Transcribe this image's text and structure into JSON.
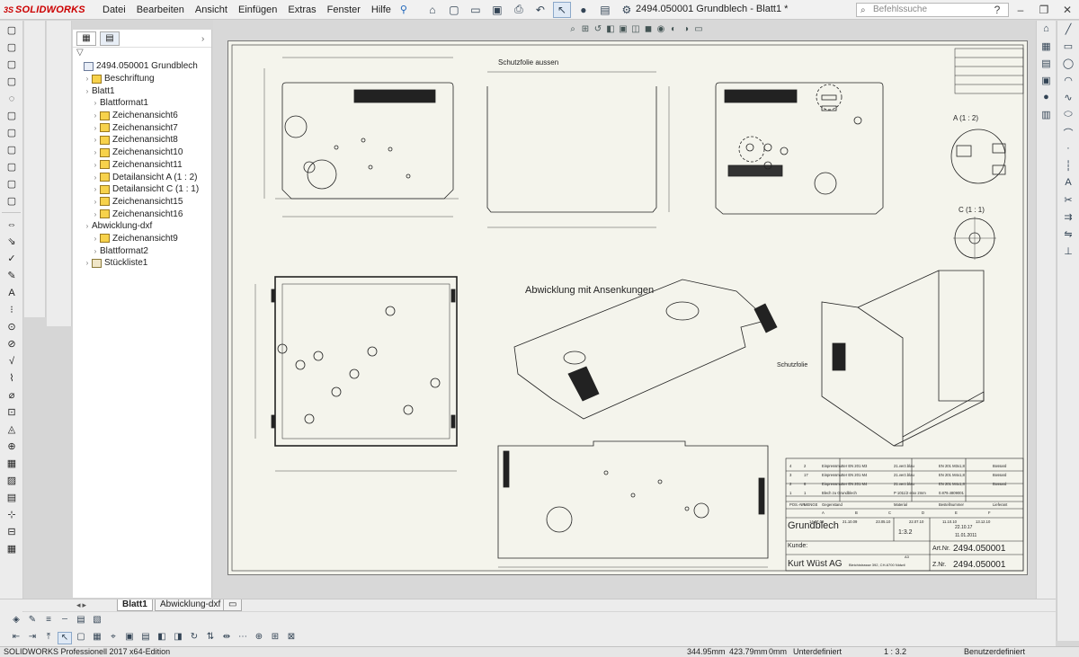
{
  "app": {
    "logo_prefix": "3S",
    "logo_name": "SOLIDWORKS",
    "menu": [
      "Datei",
      "Bearbeiten",
      "Ansicht",
      "Einfügen",
      "Extras",
      "Fenster",
      "Hilfe"
    ],
    "document_title": "2494.050001 Grundblech - Blatt1 *",
    "search_placeholder": "Befehlssuche"
  },
  "feature_tree": {
    "nodes": [
      {
        "label": "2494.050001 Grundblech",
        "level": 0,
        "icon": "drawing-icon"
      },
      {
        "label": "Beschriftung",
        "level": 1,
        "icon": "annotation-folder-icon"
      },
      {
        "label": "Blatt1",
        "level": 1,
        "icon": "sheet-icon"
      },
      {
        "label": "Blattformat1",
        "level": 2,
        "icon": "sheet-format-icon"
      },
      {
        "label": "Zeichenansicht6",
        "level": 2,
        "icon": "drawing-view-icon"
      },
      {
        "label": "Zeichenansicht7",
        "level": 2,
        "icon": "drawing-view-icon"
      },
      {
        "label": "Zeichenansicht8",
        "level": 2,
        "icon": "drawing-view-icon"
      },
      {
        "label": "Zeichenansicht10",
        "level": 2,
        "icon": "drawing-view-icon"
      },
      {
        "label": "Zeichenansicht11",
        "level": 2,
        "icon": "drawing-view-icon"
      },
      {
        "label": "Detailansicht A (1 : 2)",
        "level": 2,
        "icon": "detail-view-icon"
      },
      {
        "label": "Detailansicht C (1 : 1)",
        "level": 2,
        "icon": "detail-view-icon"
      },
      {
        "label": "Zeichenansicht15",
        "level": 2,
        "icon": "drawing-view-icon"
      },
      {
        "label": "Zeichenansicht16",
        "level": 2,
        "icon": "drawing-view-icon"
      },
      {
        "label": "Abwicklung-dxf",
        "level": 1,
        "icon": "sheet-icon"
      },
      {
        "label": "Zeichenansicht9",
        "level": 2,
        "icon": "drawing-view-icon"
      },
      {
        "label": "Blattformat2",
        "level": 2,
        "icon": "sheet-format-icon"
      },
      {
        "label": "Stückliste1",
        "level": 1,
        "icon": "bom-table-icon"
      }
    ]
  },
  "sheet_tabs": [
    {
      "label": "Blatt1",
      "active": true
    },
    {
      "label": "Abwicklung-dxf",
      "active": false
    }
  ],
  "drawing": {
    "label_schutzfolie_aussen": "Schutzfolie aussen",
    "label_abwicklung": "Abwicklung mit Ansenkungen",
    "label_schutzfolie": "Schutzfolie",
    "detail_a": "A (1 : 2)",
    "detail_c": "C (1 : 1)",
    "title_block": {
      "part_name": "Grundblech",
      "customer_label": "Kunde:",
      "company": "Kurt Wüst AG",
      "address": "Bleichistrasse 392, CH-6700 Nidwil",
      "artnr_label": "Art.Nr.",
      "artnr": "2494.050001",
      "znr_label": "Z.Nr.",
      "znr": "2494.050001",
      "scale": "1:3.2",
      "format": "A3",
      "drawn_date": "22.10.17",
      "checked_date": "11.01.2011",
      "bom_rows": [
        {
          "pos": "4",
          "qty": "2",
          "item": "Einpressmutter EN 201 M3",
          "material": "21.verz.blau",
          "norm": "EN 201 M3x1,8",
          "supplier": "Bossard"
        },
        {
          "pos": "3",
          "qty": "17",
          "item": "Einpressmutter EN 201 M4",
          "material": "21.verz.blau",
          "norm": "EN 201 M4x1,8",
          "supplier": "Bossard"
        },
        {
          "pos": "2",
          "qty": "8",
          "item": "Einpressmutter EN 201 M4",
          "material": "21.verz.blau",
          "norm": "EN 201 M4x1,8",
          "supplier": "Bossard"
        },
        {
          "pos": "1",
          "qty": "1",
          "item": "Blech zu Grundblech",
          "material": "P 1011/2 elox 2mm",
          "norm": "0.879.4809001",
          "supplier": ""
        }
      ],
      "bom_header": [
        "POS.-NR.",
        "MENGE",
        "Gegenstand",
        "Material",
        "Bestellnummer",
        "Lieferant"
      ],
      "revisions": [
        "A",
        "B",
        "C",
        "D",
        "E",
        "F"
      ],
      "revision_dates": [
        "14.07.09",
        "21.10.09",
        "23.05.10",
        "22.07.10",
        "11.10.10",
        "13.12.10"
      ]
    }
  },
  "status_bar": {
    "product": "SOLIDWORKS Professionell 2017 x64-Edition",
    "x": "344.95mm",
    "y": "423.79mm",
    "z": "0mm",
    "state": "Unterdefiniert",
    "scale": "1 : 3.2",
    "units": "Benutzerdefiniert"
  }
}
